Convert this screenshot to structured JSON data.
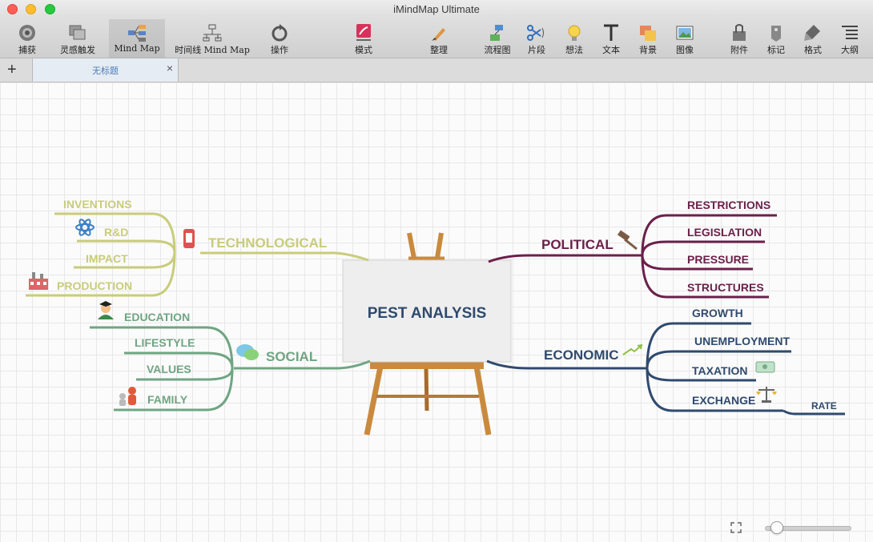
{
  "window": {
    "title": "iMindMap Ultimate"
  },
  "toolbar": {
    "capture": "捕获",
    "inspire": "灵感触发",
    "mindmap": "Mind Map",
    "timeline": "时间线 Mind Map",
    "operation": "操作",
    "mode": "模式",
    "organize": "整理",
    "flowchart": "流程图",
    "snippet": "片段",
    "idea": "想法",
    "text": "文本",
    "background": "背景",
    "image": "图像",
    "attachment": "附件",
    "mark": "标记",
    "format": "格式",
    "outline": "大纲"
  },
  "tabs": {
    "new_tab": "+",
    "current": "无标题",
    "close": "×"
  },
  "map": {
    "central": "PEST ANALYSIS",
    "branches": {
      "technological": {
        "label": "TECHNOLOGICAL",
        "color": "#c9cc7a",
        "items": [
          "INVENTIONS",
          "R&D",
          "IMPACT",
          "PRODUCTION"
        ]
      },
      "social": {
        "label": "SOCIAL",
        "color": "#6fa582",
        "items": [
          "EDUCATION",
          "LIFESTYLE",
          "VALUES",
          "FAMILY"
        ]
      },
      "political": {
        "label": "POLITICAL",
        "color": "#6b1f4a",
        "items": [
          "RESTRICTIONS",
          "LEGISLATION",
          "PRESSURE",
          "STRUCTURES"
        ]
      },
      "economic": {
        "label": "ECONOMIC",
        "color": "#2f4a6e",
        "items": [
          "GROWTH",
          "UNEMPLOYMENT",
          "TAXATION",
          "EXCHANGE"
        ],
        "sub": "RATE"
      }
    }
  },
  "icons": {
    "capture": "camera-iris-icon",
    "inspire": "stack-icon",
    "mindmap": "mindmap-icon",
    "timeline": "timeline-icon",
    "operation": "rotate-icon",
    "mode": "mode-icon",
    "organize": "brush-icon",
    "flowchart": "flowchart-icon",
    "snippet": "scissors-icon",
    "idea": "lightbulb-icon",
    "text": "text-t-icon",
    "background": "background-icon",
    "image": "picture-icon",
    "attachment": "paperclip-icon",
    "mark": "tag-icon",
    "format": "format-brush-icon",
    "outline": "outline-list-icon"
  }
}
